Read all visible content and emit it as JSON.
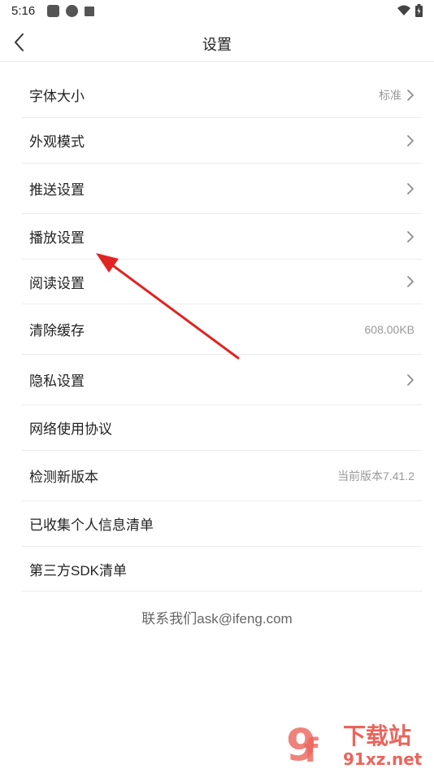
{
  "status_bar": {
    "time": "5:16",
    "icons_left": [
      "weibo-icon",
      "app-icon",
      "a-icon"
    ],
    "icons_right": [
      "wifi-icon",
      "battery-icon"
    ]
  },
  "header": {
    "title": "设置",
    "back_icon": "chevron-left-icon"
  },
  "settings": {
    "items": [
      {
        "label": "字体大小",
        "value": "标准",
        "chevron": true
      },
      {
        "label": "外观模式",
        "value": "",
        "chevron": true
      },
      {
        "label": "推送设置",
        "value": "",
        "chevron": true
      },
      {
        "label": "播放设置",
        "value": "",
        "chevron": true
      },
      {
        "label": "阅读设置",
        "value": "",
        "chevron": true
      },
      {
        "label": "清除缓存",
        "value": "608.00KB",
        "chevron": false
      },
      {
        "label": "隐私设置",
        "value": "",
        "chevron": true
      },
      {
        "label": "网络使用协议",
        "value": "",
        "chevron": false
      },
      {
        "label": "检测新版本",
        "value": "当前版本7.41.2",
        "chevron": false
      },
      {
        "label": "已收集个人信息清单",
        "value": "",
        "chevron": false
      },
      {
        "label": "第三方SDK清单",
        "value": "",
        "chevron": false
      }
    ]
  },
  "contact": {
    "text": "联系我们ask@ifeng.com"
  },
  "annotation": {
    "arrow_color": "#e02424"
  },
  "watermark": {
    "brand_text": "下载站",
    "site_text": "91xz.net",
    "brand_color": "#e8493f"
  }
}
